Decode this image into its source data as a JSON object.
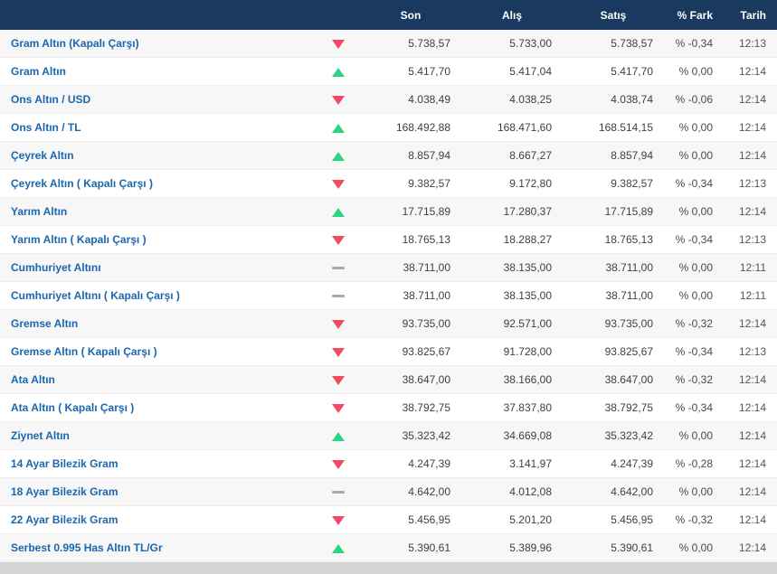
{
  "colors": {
    "header-bg": "#19395e",
    "name": "#1a67b0",
    "up": "#2ed47f",
    "down": "#f24a63",
    "flat": "#a8a8a8"
  },
  "table": {
    "headers": {
      "son": "Son",
      "alis": "Alış",
      "satis": "Satış",
      "fark": "% Fark",
      "tarih": "Tarih"
    },
    "rows": [
      {
        "name": "Gram Altın (Kapalı Çarşı)",
        "dir": "down",
        "son": "5.738,57",
        "alis": "5.733,00",
        "satis": "5.738,57",
        "fark": "% -0,34",
        "tarih": "12:13"
      },
      {
        "name": "Gram Altın",
        "dir": "up",
        "son": "5.417,70",
        "alis": "5.417,04",
        "satis": "5.417,70",
        "fark": "% 0,00",
        "tarih": "12:14"
      },
      {
        "name": "Ons Altın / USD",
        "dir": "down",
        "son": "4.038,49",
        "alis": "4.038,25",
        "satis": "4.038,74",
        "fark": "% -0,06",
        "tarih": "12:14"
      },
      {
        "name": "Ons Altın / TL",
        "dir": "up",
        "son": "168.492,88",
        "alis": "168.471,60",
        "satis": "168.514,15",
        "fark": "% 0,00",
        "tarih": "12:14"
      },
      {
        "name": "Çeyrek Altın",
        "dir": "up",
        "son": "8.857,94",
        "alis": "8.667,27",
        "satis": "8.857,94",
        "fark": "% 0,00",
        "tarih": "12:14"
      },
      {
        "name": "Çeyrek Altın ( Kapalı Çarşı )",
        "dir": "down",
        "son": "9.382,57",
        "alis": "9.172,80",
        "satis": "9.382,57",
        "fark": "% -0,34",
        "tarih": "12:13"
      },
      {
        "name": "Yarım Altın",
        "dir": "up",
        "son": "17.715,89",
        "alis": "17.280,37",
        "satis": "17.715,89",
        "fark": "% 0,00",
        "tarih": "12:14"
      },
      {
        "name": "Yarım Altın ( Kapalı Çarşı )",
        "dir": "down",
        "son": "18.765,13",
        "alis": "18.288,27",
        "satis": "18.765,13",
        "fark": "% -0,34",
        "tarih": "12:13"
      },
      {
        "name": "Cumhuriyet Altını",
        "dir": "flat",
        "son": "38.711,00",
        "alis": "38.135,00",
        "satis": "38.711,00",
        "fark": "% 0,00",
        "tarih": "12:11"
      },
      {
        "name": "Cumhuriyet Altını ( Kapalı Çarşı )",
        "dir": "flat",
        "son": "38.711,00",
        "alis": "38.135,00",
        "satis": "38.711,00",
        "fark": "% 0,00",
        "tarih": "12:11"
      },
      {
        "name": "Gremse Altın",
        "dir": "down",
        "son": "93.735,00",
        "alis": "92.571,00",
        "satis": "93.735,00",
        "fark": "% -0,32",
        "tarih": "12:14"
      },
      {
        "name": "Gremse Altın ( Kapalı Çarşı )",
        "dir": "down",
        "son": "93.825,67",
        "alis": "91.728,00",
        "satis": "93.825,67",
        "fark": "% -0,34",
        "tarih": "12:13"
      },
      {
        "name": "Ata Altın",
        "dir": "down",
        "son": "38.647,00",
        "alis": "38.166,00",
        "satis": "38.647,00",
        "fark": "% -0,32",
        "tarih": "12:14"
      },
      {
        "name": "Ata Altın ( Kapalı Çarşı )",
        "dir": "down",
        "son": "38.792,75",
        "alis": "37.837,80",
        "satis": "38.792,75",
        "fark": "% -0,34",
        "tarih": "12:14"
      },
      {
        "name": "Ziynet Altın",
        "dir": "up",
        "son": "35.323,42",
        "alis": "34.669,08",
        "satis": "35.323,42",
        "fark": "% 0,00",
        "tarih": "12:14"
      },
      {
        "name": "14 Ayar Bilezik Gram",
        "dir": "down",
        "son": "4.247,39",
        "alis": "3.141,97",
        "satis": "4.247,39",
        "fark": "% -0,28",
        "tarih": "12:14"
      },
      {
        "name": "18 Ayar Bilezik Gram",
        "dir": "flat",
        "son": "4.642,00",
        "alis": "4.012,08",
        "satis": "4.642,00",
        "fark": "% 0,00",
        "tarih": "12:14"
      },
      {
        "name": "22 Ayar Bilezik Gram",
        "dir": "down",
        "son": "5.456,95",
        "alis": "5.201,20",
        "satis": "5.456,95",
        "fark": "% -0,32",
        "tarih": "12:14"
      },
      {
        "name": "Serbest 0.995 Has Altın TL/Gr",
        "dir": "up",
        "son": "5.390,61",
        "alis": "5.389,96",
        "satis": "5.390,61",
        "fark": "% 0,00",
        "tarih": "12:14"
      }
    ]
  }
}
